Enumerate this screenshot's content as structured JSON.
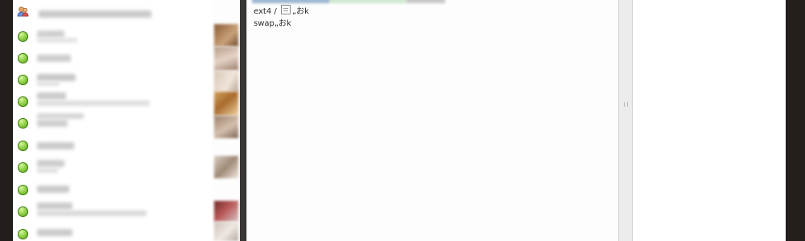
{
  "chat_log": {
    "lines": [
      {
        "prefix": "ext4 / ",
        "suffix": "„おk"
      },
      {
        "text": "swap„おk"
      }
    ]
  },
  "contacts": {
    "status_color": "#7cc23a",
    "rows": [
      {
        "status": "group-icon"
      },
      {
        "status": "online"
      },
      {
        "status": "online"
      },
      {
        "status": "online"
      },
      {
        "status": "online"
      },
      {
        "status": "online"
      },
      {
        "status": "online"
      },
      {
        "status": "online"
      },
      {
        "status": "online"
      },
      {
        "status": "online"
      },
      {
        "status": "online"
      }
    ]
  }
}
